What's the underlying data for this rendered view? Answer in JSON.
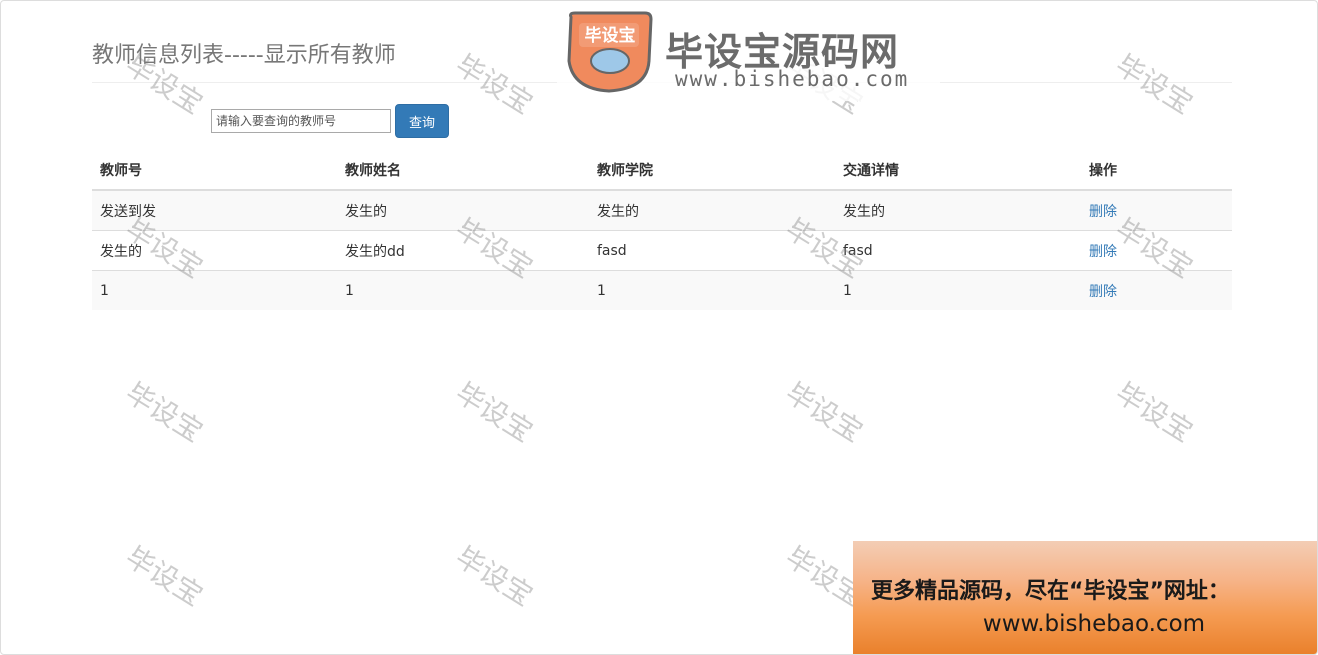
{
  "panel": {
    "title": "教师信息列表-----显示所有教师"
  },
  "search": {
    "placeholder": "请输入要查询的教师号",
    "value": "",
    "button_label": "查询"
  },
  "table": {
    "headers": [
      "教师号",
      "教师姓名",
      "教师学院",
      "交通详情",
      "操作"
    ],
    "rows": [
      [
        "发送到发",
        "发生的",
        "发生的",
        "发生的",
        "删除"
      ],
      [
        "发生的",
        "发生的dd",
        "fasd",
        "fasd",
        "删除"
      ],
      [
        "1",
        "1",
        "1",
        "1",
        "删除"
      ]
    ]
  },
  "watermark": {
    "text": "毕设宝"
  },
  "logo": {
    "badge_text": "毕设宝",
    "name": "毕设宝源码网",
    "url": "www.bishebao.com"
  },
  "promo": {
    "line1": "更多精品源码，尽在“毕设宝”网址：",
    "line2": "www.bishebao.com"
  },
  "colors": {
    "primary": "#337ab7",
    "logo_orange": "#f08a5d",
    "logo_blue": "#9ec8e8"
  }
}
